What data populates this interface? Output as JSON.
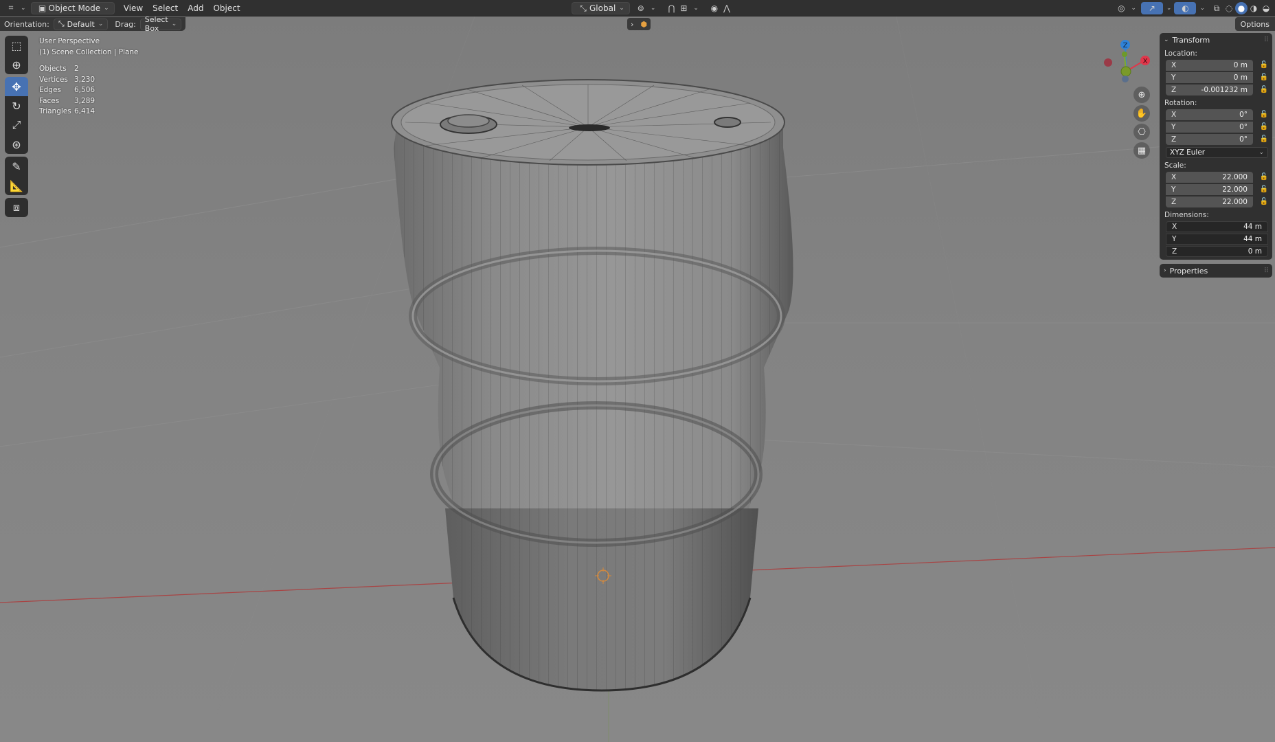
{
  "header": {
    "editor_type_icon": "axes-icon",
    "mode": "Object Mode",
    "menus": [
      "View",
      "Select",
      "Add",
      "Object"
    ],
    "transform_orientation": "Global"
  },
  "tool_settings": {
    "orientation_label": "Orientation:",
    "orientation_value": "Default",
    "drag_label": "Drag:",
    "drag_value": "Select Box",
    "options_label": "Options"
  },
  "left_tools": [
    "select-box",
    "cursor",
    "move",
    "rotate",
    "scale",
    "transform",
    "annotate",
    "measure",
    "add-cube"
  ],
  "overlay": {
    "view_name": "User Perspective",
    "collection": "(1) Scene Collection | Plane",
    "stats": [
      {
        "label": "Objects",
        "value": "2"
      },
      {
        "label": "Vertices",
        "value": "3,230"
      },
      {
        "label": "Edges",
        "value": "6,506"
      },
      {
        "label": "Faces",
        "value": "3,289"
      },
      {
        "label": "Triangles",
        "value": "6,414"
      }
    ]
  },
  "gizmo": {
    "z_label": "Z",
    "x_label": "X",
    "colors": {
      "x": "#e0364a",
      "y": "#7dac2a",
      "z": "#2f83d9"
    }
  },
  "npanel": {
    "transform_title": "Transform",
    "location_label": "Location:",
    "location": [
      {
        "axis": "X",
        "value": "0 m"
      },
      {
        "axis": "Y",
        "value": "0 m"
      },
      {
        "axis": "Z",
        "value": "-0.001232 m"
      }
    ],
    "rotation_label": "Rotation:",
    "rotation": [
      {
        "axis": "X",
        "value": "0°"
      },
      {
        "axis": "Y",
        "value": "0°"
      },
      {
        "axis": "Z",
        "value": "0°"
      }
    ],
    "rotation_mode": "XYZ Euler",
    "scale_label": "Scale:",
    "scale": [
      {
        "axis": "X",
        "value": "22.000"
      },
      {
        "axis": "Y",
        "value": "22.000"
      },
      {
        "axis": "Z",
        "value": "22.000"
      }
    ],
    "dimensions_label": "Dimensions:",
    "dimensions": [
      {
        "axis": "X",
        "value": "44 m"
      },
      {
        "axis": "Y",
        "value": "44 m"
      },
      {
        "axis": "Z",
        "value": "0 m"
      }
    ],
    "properties_title": "Properties"
  },
  "colors": {
    "active_tool": "#4772b3",
    "x_axis_line": "#b24040"
  }
}
